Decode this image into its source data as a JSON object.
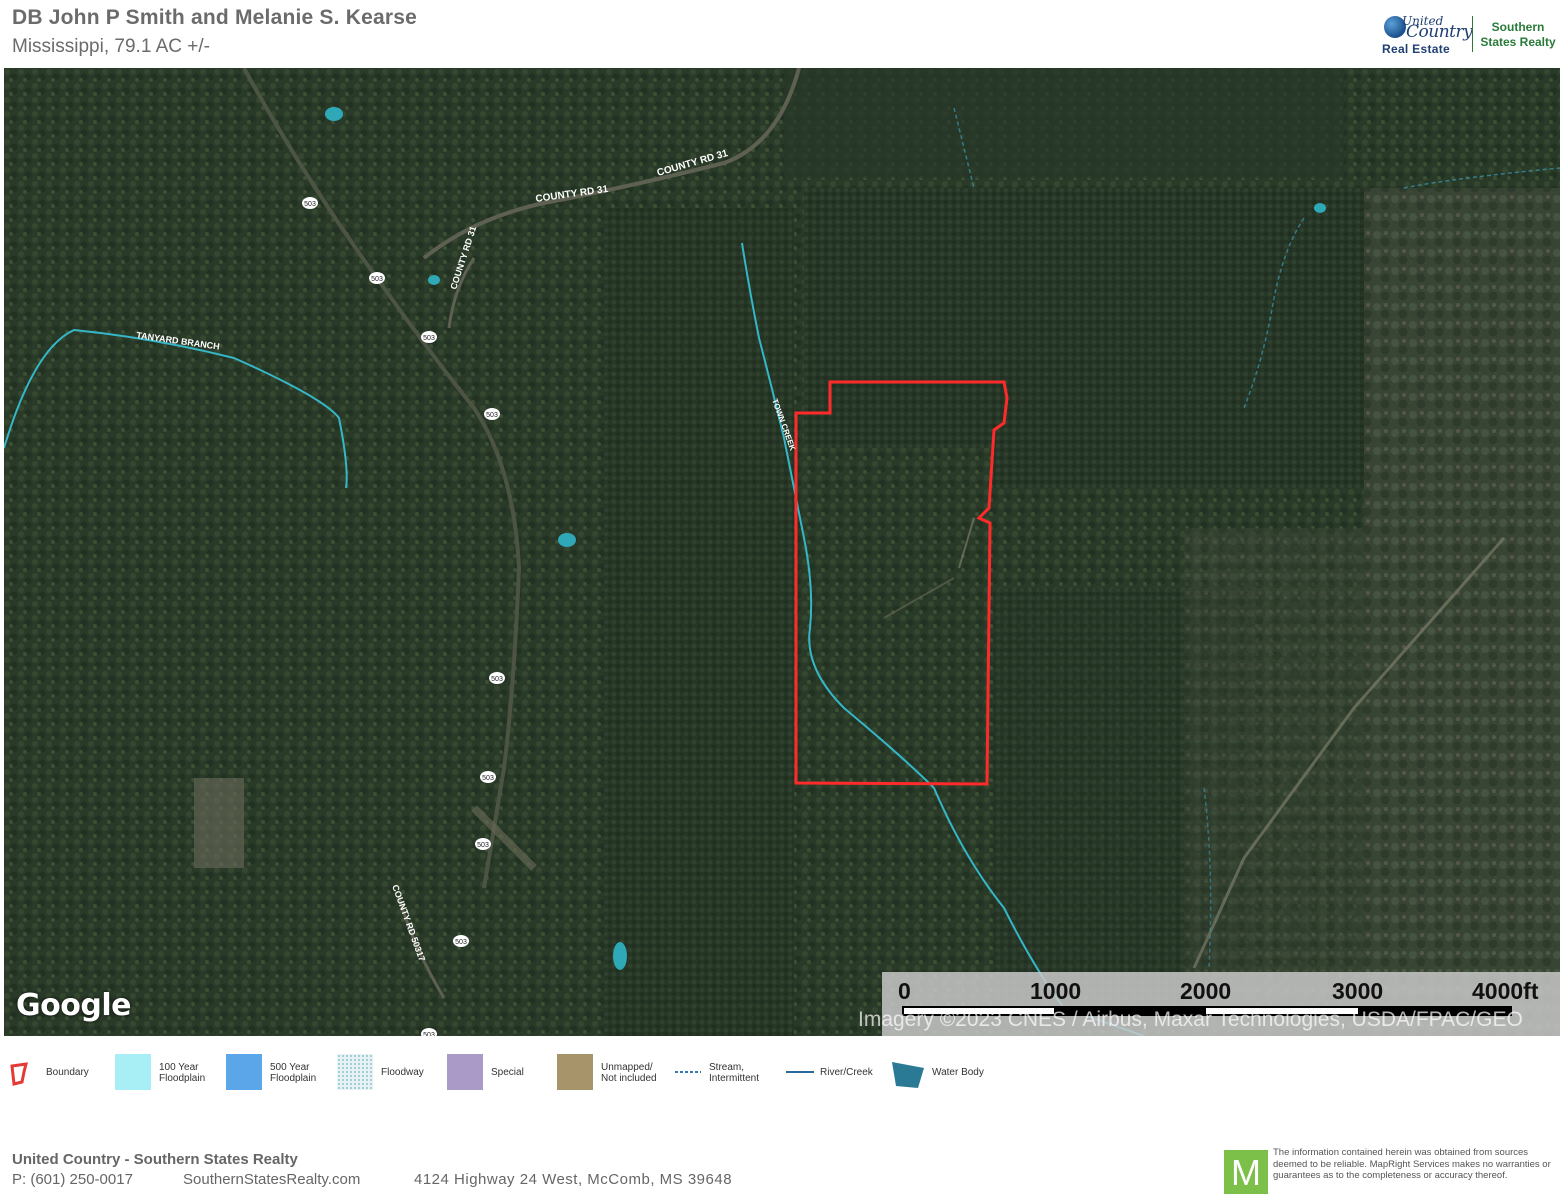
{
  "header": {
    "title": "DB John P Smith and Melanie S. Kearse",
    "subtitle": "Mississippi, 79.1 AC +/-"
  },
  "logo": {
    "united": "United",
    "country": "Country",
    "real_estate": "Real Estate",
    "brand_line1": "Southern",
    "brand_line2": "States Realty"
  },
  "map": {
    "roads": {
      "county_rd_31_a": "COUNTY RD 31",
      "county_rd_31_b": "COUNTY RD 31",
      "county_rd_31_c": "COUNTY RD 31",
      "county_rd_50317": "COUNTY RD 50317",
      "route_503": "503"
    },
    "streams": {
      "tanyard_branch": "TANYARD BRANCH",
      "town_creek": "TOWN CREEK"
    },
    "attribution": "Google",
    "imagery_credit": "Imagery ©2023 CNES / Airbus, Maxar Technologies, USDA/FPAC/GEO"
  },
  "scale": {
    "labels": [
      "0",
      "1000",
      "2000",
      "3000",
      "4000ft"
    ]
  },
  "legend": [
    {
      "label": "Boundary",
      "color": "#e53935",
      "icon": "boundary-icon"
    },
    {
      "label": "100 Year\nFloodplain",
      "color": "#a8eff5",
      "icon": "floodplain-100-icon"
    },
    {
      "label": "500 Year\nFloodplain",
      "color": "#5aa6e8",
      "icon": "floodplain-500-icon"
    },
    {
      "label": "Floodway",
      "color": "#c8e4ea",
      "icon": "floodway-icon"
    },
    {
      "label": "Special",
      "color": "#a99ac8",
      "icon": "special-icon"
    },
    {
      "label": "Unmapped/\nNot included",
      "color": "#a8946a",
      "icon": "unmapped-icon"
    },
    {
      "label": "Stream,\nIntermittent",
      "color": "#3a7ab0",
      "icon": "stream-intermittent-icon"
    },
    {
      "label": "River/Creek",
      "color": "#2a6a9a",
      "icon": "river-creek-icon"
    },
    {
      "label": "Water Body",
      "color": "#2a7a96",
      "icon": "water-body-icon"
    }
  ],
  "footer": {
    "company": "United Country - Southern States Realty",
    "phone": "P: (601) 250-0017",
    "website": "SouthernStatesRealty.com",
    "address": "4124 Highway 24 West, McComb, MS 39648",
    "disclaimer": "The information contained herein was obtained from sources deemed to be reliable. MapRight Services makes no warranties or guarantees as to the completeness or accuracy thereof.",
    "mapright_letter": "M"
  },
  "colors": {
    "boundary": "#ff2a2a",
    "stream": "#35b7c8",
    "forest_dark": "#223322",
    "forest_mid": "#34452f"
  }
}
